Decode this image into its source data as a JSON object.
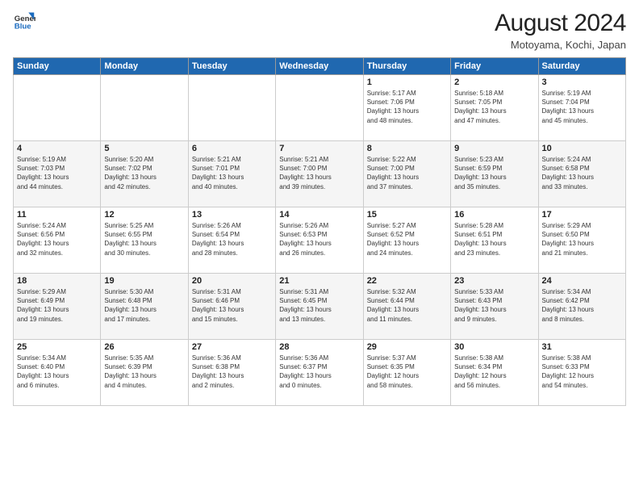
{
  "logo": {
    "line1": "General",
    "line2": "Blue"
  },
  "title": "August 2024",
  "location": "Motoyama, Kochi, Japan",
  "days_of_week": [
    "Sunday",
    "Monday",
    "Tuesday",
    "Wednesday",
    "Thursday",
    "Friday",
    "Saturday"
  ],
  "weeks": [
    [
      {
        "day": "",
        "info": ""
      },
      {
        "day": "",
        "info": ""
      },
      {
        "day": "",
        "info": ""
      },
      {
        "day": "",
        "info": ""
      },
      {
        "day": "1",
        "info": "Sunrise: 5:17 AM\nSunset: 7:06 PM\nDaylight: 13 hours\nand 48 minutes."
      },
      {
        "day": "2",
        "info": "Sunrise: 5:18 AM\nSunset: 7:05 PM\nDaylight: 13 hours\nand 47 minutes."
      },
      {
        "day": "3",
        "info": "Sunrise: 5:19 AM\nSunset: 7:04 PM\nDaylight: 13 hours\nand 45 minutes."
      }
    ],
    [
      {
        "day": "4",
        "info": "Sunrise: 5:19 AM\nSunset: 7:03 PM\nDaylight: 13 hours\nand 44 minutes."
      },
      {
        "day": "5",
        "info": "Sunrise: 5:20 AM\nSunset: 7:02 PM\nDaylight: 13 hours\nand 42 minutes."
      },
      {
        "day": "6",
        "info": "Sunrise: 5:21 AM\nSunset: 7:01 PM\nDaylight: 13 hours\nand 40 minutes."
      },
      {
        "day": "7",
        "info": "Sunrise: 5:21 AM\nSunset: 7:00 PM\nDaylight: 13 hours\nand 39 minutes."
      },
      {
        "day": "8",
        "info": "Sunrise: 5:22 AM\nSunset: 7:00 PM\nDaylight: 13 hours\nand 37 minutes."
      },
      {
        "day": "9",
        "info": "Sunrise: 5:23 AM\nSunset: 6:59 PM\nDaylight: 13 hours\nand 35 minutes."
      },
      {
        "day": "10",
        "info": "Sunrise: 5:24 AM\nSunset: 6:58 PM\nDaylight: 13 hours\nand 33 minutes."
      }
    ],
    [
      {
        "day": "11",
        "info": "Sunrise: 5:24 AM\nSunset: 6:56 PM\nDaylight: 13 hours\nand 32 minutes."
      },
      {
        "day": "12",
        "info": "Sunrise: 5:25 AM\nSunset: 6:55 PM\nDaylight: 13 hours\nand 30 minutes."
      },
      {
        "day": "13",
        "info": "Sunrise: 5:26 AM\nSunset: 6:54 PM\nDaylight: 13 hours\nand 28 minutes."
      },
      {
        "day": "14",
        "info": "Sunrise: 5:26 AM\nSunset: 6:53 PM\nDaylight: 13 hours\nand 26 minutes."
      },
      {
        "day": "15",
        "info": "Sunrise: 5:27 AM\nSunset: 6:52 PM\nDaylight: 13 hours\nand 24 minutes."
      },
      {
        "day": "16",
        "info": "Sunrise: 5:28 AM\nSunset: 6:51 PM\nDaylight: 13 hours\nand 23 minutes."
      },
      {
        "day": "17",
        "info": "Sunrise: 5:29 AM\nSunset: 6:50 PM\nDaylight: 13 hours\nand 21 minutes."
      }
    ],
    [
      {
        "day": "18",
        "info": "Sunrise: 5:29 AM\nSunset: 6:49 PM\nDaylight: 13 hours\nand 19 minutes."
      },
      {
        "day": "19",
        "info": "Sunrise: 5:30 AM\nSunset: 6:48 PM\nDaylight: 13 hours\nand 17 minutes."
      },
      {
        "day": "20",
        "info": "Sunrise: 5:31 AM\nSunset: 6:46 PM\nDaylight: 13 hours\nand 15 minutes."
      },
      {
        "day": "21",
        "info": "Sunrise: 5:31 AM\nSunset: 6:45 PM\nDaylight: 13 hours\nand 13 minutes."
      },
      {
        "day": "22",
        "info": "Sunrise: 5:32 AM\nSunset: 6:44 PM\nDaylight: 13 hours\nand 11 minutes."
      },
      {
        "day": "23",
        "info": "Sunrise: 5:33 AM\nSunset: 6:43 PM\nDaylight: 13 hours\nand 9 minutes."
      },
      {
        "day": "24",
        "info": "Sunrise: 5:34 AM\nSunset: 6:42 PM\nDaylight: 13 hours\nand 8 minutes."
      }
    ],
    [
      {
        "day": "25",
        "info": "Sunrise: 5:34 AM\nSunset: 6:40 PM\nDaylight: 13 hours\nand 6 minutes."
      },
      {
        "day": "26",
        "info": "Sunrise: 5:35 AM\nSunset: 6:39 PM\nDaylight: 13 hours\nand 4 minutes."
      },
      {
        "day": "27",
        "info": "Sunrise: 5:36 AM\nSunset: 6:38 PM\nDaylight: 13 hours\nand 2 minutes."
      },
      {
        "day": "28",
        "info": "Sunrise: 5:36 AM\nSunset: 6:37 PM\nDaylight: 13 hours\nand 0 minutes."
      },
      {
        "day": "29",
        "info": "Sunrise: 5:37 AM\nSunset: 6:35 PM\nDaylight: 12 hours\nand 58 minutes."
      },
      {
        "day": "30",
        "info": "Sunrise: 5:38 AM\nSunset: 6:34 PM\nDaylight: 12 hours\nand 56 minutes."
      },
      {
        "day": "31",
        "info": "Sunrise: 5:38 AM\nSunset: 6:33 PM\nDaylight: 12 hours\nand 54 minutes."
      }
    ]
  ]
}
